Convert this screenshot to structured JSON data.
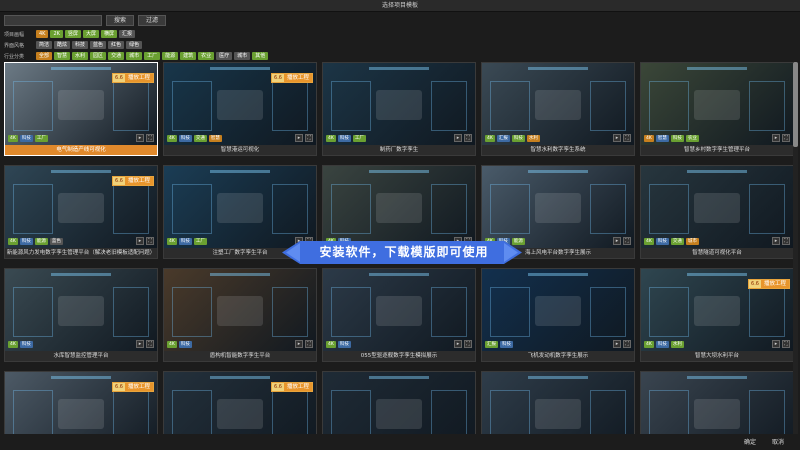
{
  "window": {
    "title": "选择项目模板"
  },
  "search": {
    "value": "",
    "placeholder": "",
    "search_label": "搜索",
    "filter_label": "过滤"
  },
  "filters": [
    {
      "label": "项目画幅",
      "tags": [
        {
          "text": "4K",
          "color": "#c67f1e"
        },
        {
          "text": "2K",
          "color": "#6aa031"
        },
        {
          "text": "竖屏",
          "color": "#6aa031"
        },
        {
          "text": "大屏",
          "color": "#6aa031"
        },
        {
          "text": "横屏",
          "color": "#6aa031"
        },
        {
          "text": "汇报",
          "color": "#555555"
        }
      ]
    },
    {
      "label": "界面风格",
      "tags": [
        {
          "text": "简洁",
          "color": "#555555"
        },
        {
          "text": "酷炫",
          "color": "#555555"
        },
        {
          "text": "科技",
          "color": "#555555"
        },
        {
          "text": "蓝色",
          "color": "#555555"
        },
        {
          "text": "红色",
          "color": "#555555"
        },
        {
          "text": "绿色",
          "color": "#555555"
        }
      ]
    },
    {
      "label": "行业分类",
      "tags": [
        {
          "text": "全部",
          "color": "#c67f1e"
        },
        {
          "text": "智慧",
          "color": "#6aa031"
        },
        {
          "text": "水利",
          "color": "#6aa031"
        },
        {
          "text": "园区",
          "color": "#6aa031"
        },
        {
          "text": "交通",
          "color": "#6aa031"
        },
        {
          "text": "城市",
          "color": "#6aa031"
        },
        {
          "text": "工厂",
          "color": "#6aa031"
        },
        {
          "text": "能源",
          "color": "#6aa031"
        },
        {
          "text": "建筑",
          "color": "#6aa031"
        },
        {
          "text": "农业",
          "color": "#6aa031"
        },
        {
          "text": "医疗",
          "color": "#555555"
        },
        {
          "text": "城市",
          "color": "#555555"
        },
        {
          "text": "其他",
          "color": "#6aa031"
        }
      ]
    }
  ],
  "cards": [
    {
      "label": "电气制造产线可视化",
      "selected": true,
      "bg": "#6c7a85",
      "stamp_num": "6.6",
      "stamp_text": "播放工程",
      "badges": [
        {
          "text": "4K",
          "color": "#6aa031"
        },
        {
          "text": "科技",
          "color": "#3d6aa3"
        },
        {
          "text": "工厂",
          "color": "#6aa031"
        }
      ]
    },
    {
      "label": "智慧港运可视化",
      "selected": false,
      "bg": "#18364a",
      "stamp_num": "6.6",
      "stamp_text": "播放工程",
      "badges": [
        {
          "text": "4K",
          "color": "#6aa031"
        },
        {
          "text": "科技",
          "color": "#3d6aa3"
        },
        {
          "text": "交通",
          "color": "#6aa031"
        },
        {
          "text": "智慧",
          "color": "#c67f1e"
        }
      ]
    },
    {
      "label": "制药厂数字孪生",
      "selected": false,
      "bg": "#1c3546",
      "stamp_num": "",
      "stamp_text": "",
      "badges": [
        {
          "text": "4K",
          "color": "#6aa031"
        },
        {
          "text": "科技",
          "color": "#3d6aa3"
        },
        {
          "text": "工厂",
          "color": "#6aa031"
        }
      ]
    },
    {
      "label": "智慧水利数字孪生系统",
      "selected": false,
      "bg": "#3b4a55",
      "stamp_num": "",
      "stamp_text": "",
      "badges": [
        {
          "text": "4K",
          "color": "#6aa031"
        },
        {
          "text": "汇报",
          "color": "#3d6aa3"
        },
        {
          "text": "科技",
          "color": "#6aa031"
        },
        {
          "text": "水利",
          "color": "#c67f1e"
        }
      ]
    },
    {
      "label": "智慧乡村数字孪生管理平台",
      "selected": false,
      "bg": "#3b4738",
      "stamp_num": "",
      "stamp_text": "",
      "badges": [
        {
          "text": "4K",
          "color": "#c67f1e"
        },
        {
          "text": "智慧",
          "color": "#3d6aa3"
        },
        {
          "text": "科技",
          "color": "#6aa031"
        },
        {
          "text": "农业",
          "color": "#6aa031"
        }
      ]
    },
    {
      "label": "新能源风力发电数字孪生管理平台（解决老旧模板适配问题）",
      "selected": false,
      "bg": "#2f4655",
      "stamp_num": "6.6",
      "stamp_text": "播放工程",
      "badges": [
        {
          "text": "4K",
          "color": "#6aa031"
        },
        {
          "text": "科技",
          "color": "#3d6aa3"
        },
        {
          "text": "能源",
          "color": "#6aa031"
        },
        {
          "text": "蓝色",
          "color": "#555555"
        }
      ]
    },
    {
      "label": "注塑工厂数字孪生平台",
      "selected": false,
      "bg": "#1b3d55",
      "stamp_num": "",
      "stamp_text": "",
      "badges": [
        {
          "text": "4K",
          "color": "#6aa031"
        },
        {
          "text": "科技",
          "color": "#3d6aa3"
        },
        {
          "text": "工厂",
          "color": "#6aa031"
        }
      ]
    },
    {
      "label": "智慧城市应急管理平台",
      "selected": false,
      "bg": "#3a4440",
      "stamp_num": "",
      "stamp_text": "",
      "badges": [
        {
          "text": "4K",
          "color": "#6aa031"
        },
        {
          "text": "科技",
          "color": "#3d6aa3"
        }
      ]
    },
    {
      "label": "海上风电平台数字孪生展示",
      "selected": false,
      "bg": "#4a5b6a",
      "stamp_num": "",
      "stamp_text": "",
      "badges": [
        {
          "text": "4K",
          "color": "#6aa031"
        },
        {
          "text": "科技",
          "color": "#3d6aa3"
        },
        {
          "text": "能源",
          "color": "#6aa031"
        }
      ]
    },
    {
      "label": "智慧隧道可视化平台",
      "selected": false,
      "bg": "#27363e",
      "stamp_num": "",
      "stamp_text": "",
      "badges": [
        {
          "text": "4K",
          "color": "#6aa031"
        },
        {
          "text": "科技",
          "color": "#3d6aa3"
        },
        {
          "text": "交通",
          "color": "#6aa031"
        },
        {
          "text": "城市",
          "color": "#c67f1e"
        }
      ]
    },
    {
      "label": "水库智慧监控管理平台",
      "selected": false,
      "bg": "#3a4a52",
      "stamp_num": "",
      "stamp_text": "",
      "badges": [
        {
          "text": "4K",
          "color": "#6aa031"
        },
        {
          "text": "科技",
          "color": "#3d6aa3"
        }
      ]
    },
    {
      "label": "盾构机智能数字孪生平台",
      "selected": false,
      "bg": "#4a3a2a",
      "stamp_num": "",
      "stamp_text": "",
      "badges": [
        {
          "text": "4K",
          "color": "#6aa031"
        },
        {
          "text": "科技",
          "color": "#3d6aa3"
        }
      ]
    },
    {
      "label": "055型驱逐舰数字孪生模拟展示",
      "selected": false,
      "bg": "#2c3a48",
      "stamp_num": "",
      "stamp_text": "",
      "badges": [
        {
          "text": "4K",
          "color": "#6aa031"
        },
        {
          "text": "科技",
          "color": "#3d6aa3"
        }
      ]
    },
    {
      "label": "飞机发动机数字孪生展示",
      "selected": false,
      "bg": "#12304e",
      "stamp_num": "",
      "stamp_text": "",
      "badges": [
        {
          "text": "汇报",
          "color": "#6aa031"
        },
        {
          "text": "科技",
          "color": "#3d6aa3"
        }
      ]
    },
    {
      "label": "智慧大坝水利平台",
      "selected": false,
      "bg": "#2f4650",
      "stamp_num": "6.6",
      "stamp_text": "播放工程",
      "badges": [
        {
          "text": "4K",
          "color": "#6aa031"
        },
        {
          "text": "科技",
          "color": "#3d6aa3"
        },
        {
          "text": "水利",
          "color": "#6aa031"
        }
      ]
    },
    {
      "label": "",
      "selected": false,
      "bg": "#4d5a66",
      "stamp_num": "6.6",
      "stamp_text": "播放工程",
      "badges": []
    },
    {
      "label": "",
      "selected": false,
      "bg": "#24313c",
      "stamp_num": "6.6",
      "stamp_text": "播放工程",
      "badges": []
    },
    {
      "label": "",
      "selected": false,
      "bg": "#1f2b36",
      "stamp_num": "",
      "stamp_text": "",
      "badges": []
    },
    {
      "label": "",
      "selected": false,
      "bg": "#2f3d4a",
      "stamp_num": "",
      "stamp_text": "",
      "badges": []
    },
    {
      "label": "",
      "selected": false,
      "bg": "#3a4550",
      "stamp_num": "",
      "stamp_text": "",
      "badges": []
    }
  ],
  "banner": {
    "text": "安装软件，下载模版即可使用"
  },
  "footer": {
    "confirm_label": "确定",
    "cancel_label": "取消"
  },
  "colors": {
    "accent": "#e0892c",
    "green_tag": "#6aa031",
    "banner_blue": "#3f6ee0"
  }
}
